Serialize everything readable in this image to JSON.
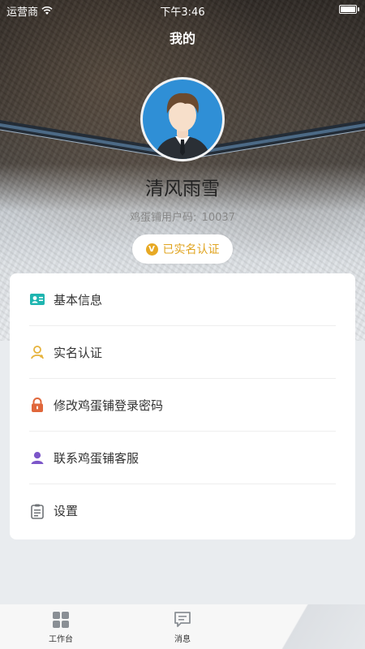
{
  "status_bar": {
    "carrier": "运营商",
    "time": "下午3:46"
  },
  "header": {
    "title": "我的"
  },
  "profile": {
    "name": "清风雨雪",
    "code_label": "鸡蛋铺用户码:",
    "code_value": "10037",
    "verified_badge": "已实名认证",
    "verified_icon_letter": "V"
  },
  "menu": {
    "items": [
      {
        "label": "基本信息",
        "icon": "id-card-icon",
        "color": "#1fb5b0"
      },
      {
        "label": "实名认证",
        "icon": "person-outline-icon",
        "color": "#e6b23a"
      },
      {
        "label": "修改鸡蛋铺登录密码",
        "icon": "lock-icon",
        "color": "#e0673b"
      },
      {
        "label": "联系鸡蛋铺客服",
        "icon": "customer-service-icon",
        "color": "#7c56c9"
      },
      {
        "label": "设置",
        "icon": "settings-clipboard-icon",
        "color": "#6f7377"
      }
    ]
  },
  "tabbar": {
    "tabs": [
      {
        "label": "工作台",
        "icon": "grid-icon"
      },
      {
        "label": "消息",
        "icon": "message-icon"
      }
    ]
  }
}
